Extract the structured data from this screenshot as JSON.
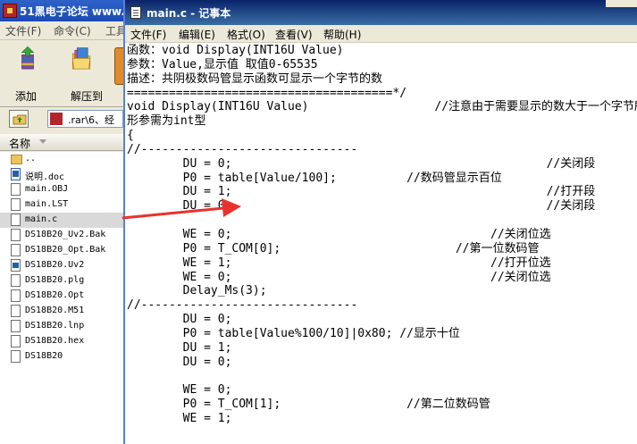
{
  "winrar": {
    "title": "51黑电子论坛 www.",
    "menu": [
      "文件(F)",
      "命令(C)",
      "工具"
    ],
    "toolbar": [
      {
        "label": "添加",
        "icon": "add-archive-icon"
      },
      {
        "label": "解压到",
        "icon": "extract-to-icon"
      }
    ],
    "address": ".rar\\6、经",
    "column_name": "名称",
    "files": [
      {
        "name": "..",
        "icon": "folder-up-icon"
      },
      {
        "name": "说明.doc",
        "icon": "word-doc-icon"
      },
      {
        "name": "main.OBJ",
        "icon": "file-icon"
      },
      {
        "name": "main.LST",
        "icon": "file-icon"
      },
      {
        "name": "main.c",
        "icon": "file-icon",
        "selected": true
      },
      {
        "name": "DS18B20_Uv2.Bak",
        "icon": "file-icon"
      },
      {
        "name": "DS18B20_Opt.Bak",
        "icon": "file-icon"
      },
      {
        "name": "DS18B20.Uv2",
        "icon": "uvision-project-icon"
      },
      {
        "name": "DS18B20.plg",
        "icon": "file-icon"
      },
      {
        "name": "DS18B20.Opt",
        "icon": "file-icon"
      },
      {
        "name": "DS18B20.M51",
        "icon": "file-icon"
      },
      {
        "name": "DS18B20.lnp",
        "icon": "file-icon"
      },
      {
        "name": "DS18B20.hex",
        "icon": "file-icon"
      },
      {
        "name": "DS18B20",
        "icon": "file-icon"
      }
    ]
  },
  "notepad": {
    "title": "main.c - 记事本",
    "menu": [
      "文件(F)",
      "编辑(E)",
      "格式(O)",
      "查看(V)",
      "帮助(H)"
    ],
    "text": "函数：void Display(INT16U Value)\n参数：Value,显示值 取值0-65535\n描述：共阴极数码管显示函数可显示一个字节的数\n======================================*/\nvoid Display(INT16U Value)                  //注意由于需要显示的数大于一个字节所以\n形参需为int型\n{\n//-------------------------------\n        DU = 0;                                             //关闭段\n        P0 = table[Value/100];          //数码管显示百位\n        DU = 1;                                             //打开段\n        DU = 0;                                             //关闭段\n\n        WE = 0;                                     //关闭位选\n        P0 = T_COM[0];                         //第一位数码管\n        WE = 1;                                     //打开位选\n        WE = 0;                                     //关闭位选\n        Delay_Ms(3);\n//-------------------------------\n        DU = 0;\n        P0 = table[Value%100/10]|0x80; //显示十位\n        DU = 1;\n        DU = 0;\n\n        WE = 0;\n        P0 = T_COM[1];                  //第二位数码管\n        WE = 1;"
  },
  "colors": {
    "arrow": "#e8322e",
    "notepad_title": "#0a246a",
    "winrar_title": "#2e63c9"
  }
}
